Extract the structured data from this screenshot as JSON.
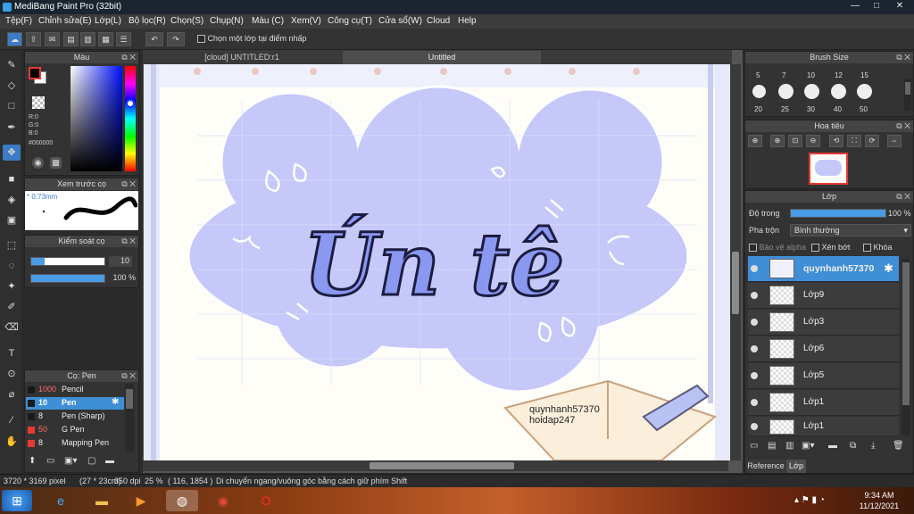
{
  "app": {
    "title": "MediBang Paint Pro (32bit)",
    "window_controls": [
      "—",
      "□",
      "✕"
    ]
  },
  "menu": [
    "Tệp(F)",
    "Chỉnh sửa(E)",
    "Lớp(L)",
    "Bộ lọc(R)",
    "Chọn(S)",
    "Chụp(N)",
    "Màu (C)",
    "Xem(V)",
    "Công cụ(T)",
    "Cửa sổ(W)",
    "Cloud",
    "Help"
  ],
  "toolbar": {
    "checkbox_label": "Chọn một lớp tại điểm nhấp"
  },
  "color_panel": {
    "title": "Màu",
    "r": "R:0",
    "g": "G:0",
    "b": "B:0",
    "hex": "#000000",
    "fg_color": "#000000",
    "bg_color": "#ffffff"
  },
  "preview_panel": {
    "title": "Xem trước cọ",
    "size": "* 0.73mm"
  },
  "brush_control": {
    "title": "Kiểm soát cọ",
    "size_value": "10",
    "opacity_value": "100 %"
  },
  "brush_list": {
    "title": "Cọ: Pen",
    "items": [
      {
        "size": "1000",
        "name": "Pencil",
        "color": "#1a1a1a"
      },
      {
        "size": "10",
        "name": "Pen",
        "color": "#1a1a1a"
      },
      {
        "size": "8",
        "name": "Pen (Sharp)",
        "color": "#1a1a1a"
      },
      {
        "size": "50",
        "name": "G Pen",
        "color": "#e53935"
      },
      {
        "size": "8",
        "name": "Mapping Pen",
        "color": "#e53935"
      }
    ]
  },
  "tabs": {
    "tab1": "[cloud] UNTITLED:r1",
    "tab2": "Untitled"
  },
  "artwork": {
    "title_text": "Ún tê",
    "watermark_line1": "quynhanh57370",
    "watermark_line2": "hoidap247",
    "cloud_color": "#c5c8f8",
    "text_color": "#8a98f0"
  },
  "brush_size_panel": {
    "title": "Brush Size",
    "top_labels": [
      "5",
      "7",
      "10",
      "12",
      "15"
    ],
    "bottom_labels": [
      "20",
      "25",
      "30",
      "40",
      "50"
    ]
  },
  "navigator_panel": {
    "title": "Hoa tiêu"
  },
  "layer_panel": {
    "title": "Lớp",
    "opacity_label": "Độ trong",
    "opacity_value": "100 %",
    "blend_label": "Pha trộn",
    "blend_value": "Bình thường",
    "protect_alpha": "Bảo vệ alpha",
    "clipping": "Xén bớt",
    "lock": "Khóa",
    "layers": [
      "quynhanh57370",
      "Lớp9",
      "Lớp3",
      "Lớp6",
      "Lớp5",
      "Lớp1",
      "Lớp1"
    ]
  },
  "bottom_tabs": {
    "reference": "Reference",
    "layer": "Lớp"
  },
  "status": {
    "pixels": "3720 * 3169 pixel",
    "cm": "(27 * 23cm)",
    "dpi": "350 dpi",
    "zoom": "25 %",
    "coords": "( 116, 1854 )",
    "hint": "Di chuyển ngang/vuông góc bằng cách giữ phím Shift"
  },
  "taskbar": {
    "time": "9:34 AM",
    "date": "11/12/2021"
  }
}
